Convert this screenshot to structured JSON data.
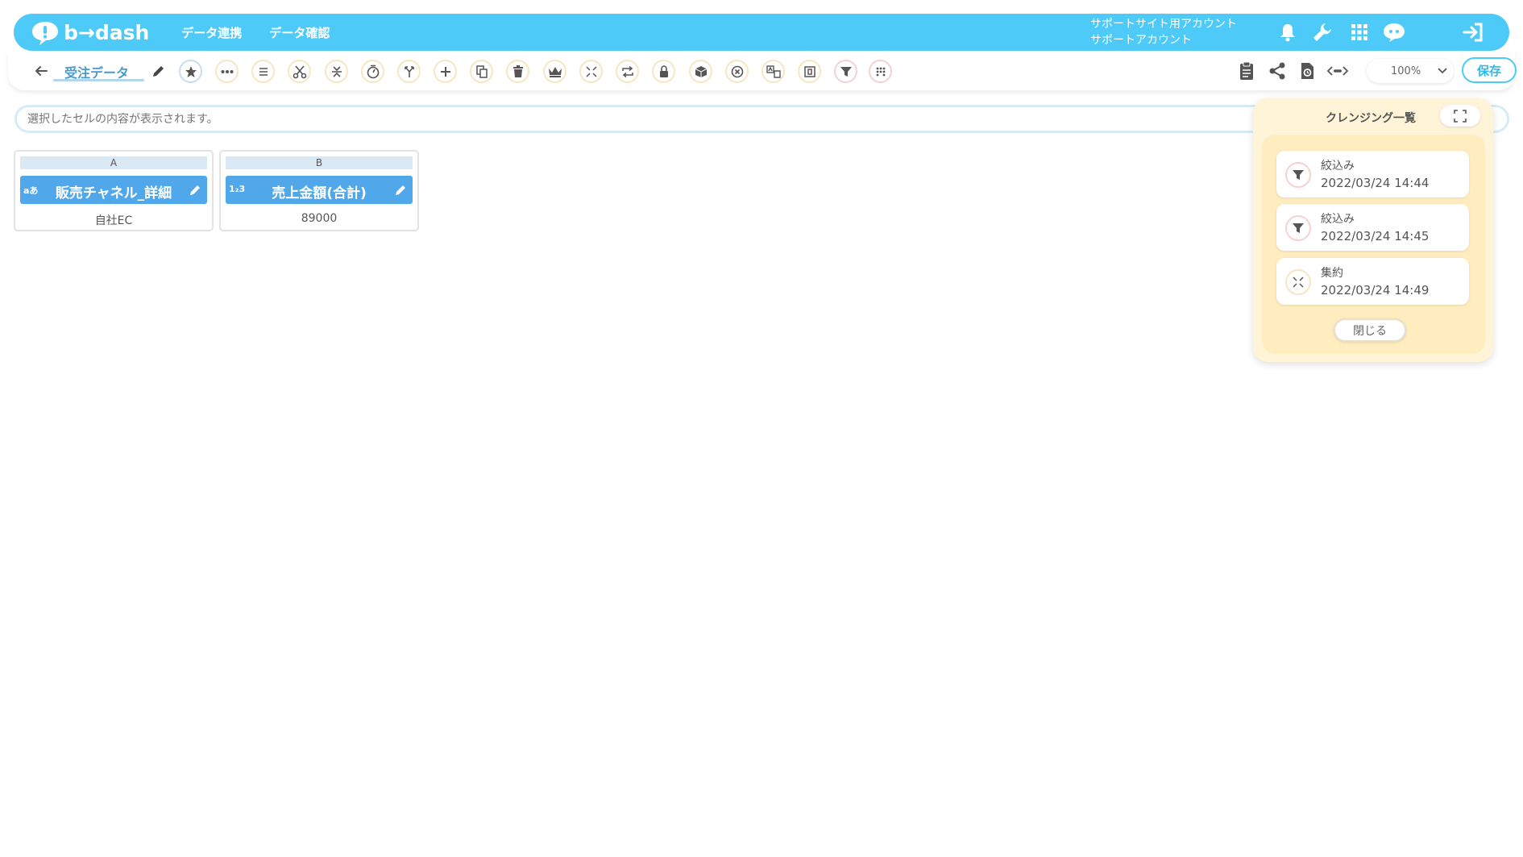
{
  "header": {
    "logo_text": "b→dash",
    "nav": [
      "データ連携",
      "データ確認"
    ],
    "account_line1": "サポートサイト用アカウント",
    "account_line2": "サポートアカウント",
    "icons": [
      "bell-icon",
      "wrench-icon",
      "apps-grid-icon",
      "chat-robot-icon",
      "logout-icon"
    ],
    "brand_color": "#4dcaf8"
  },
  "toolbar": {
    "title": "受注データ",
    "zoom": "100%",
    "save_label": "保存",
    "tools": [
      "star",
      "more",
      "list",
      "scissors",
      "merge",
      "timer",
      "branch",
      "plus",
      "copy",
      "trash",
      "crown",
      "compress",
      "repeat",
      "lock",
      "package",
      "close-circle",
      "translate",
      "box",
      "filter",
      "grid"
    ]
  },
  "cellbar": {
    "placeholder": "選択したセルの内容が表示されます。"
  },
  "columns": [
    {
      "letter": "A",
      "type": "aあ",
      "name": "販売チャネル_詳細",
      "value": "自社EC"
    },
    {
      "letter": "B",
      "type": "1₂3",
      "name": "売上金額(合計)",
      "value": "89000"
    }
  ],
  "panel": {
    "title": "クレンジング一覧",
    "steps": [
      {
        "label": "絞込み",
        "time": "2022/03/24 14:44",
        "icon": "filter-icon"
      },
      {
        "label": "絞込み",
        "time": "2022/03/24 14:45",
        "icon": "filter-icon"
      },
      {
        "label": "集約",
        "time": "2022/03/24 14:49",
        "icon": "compress-icon"
      }
    ],
    "close_label": "閉じる"
  }
}
